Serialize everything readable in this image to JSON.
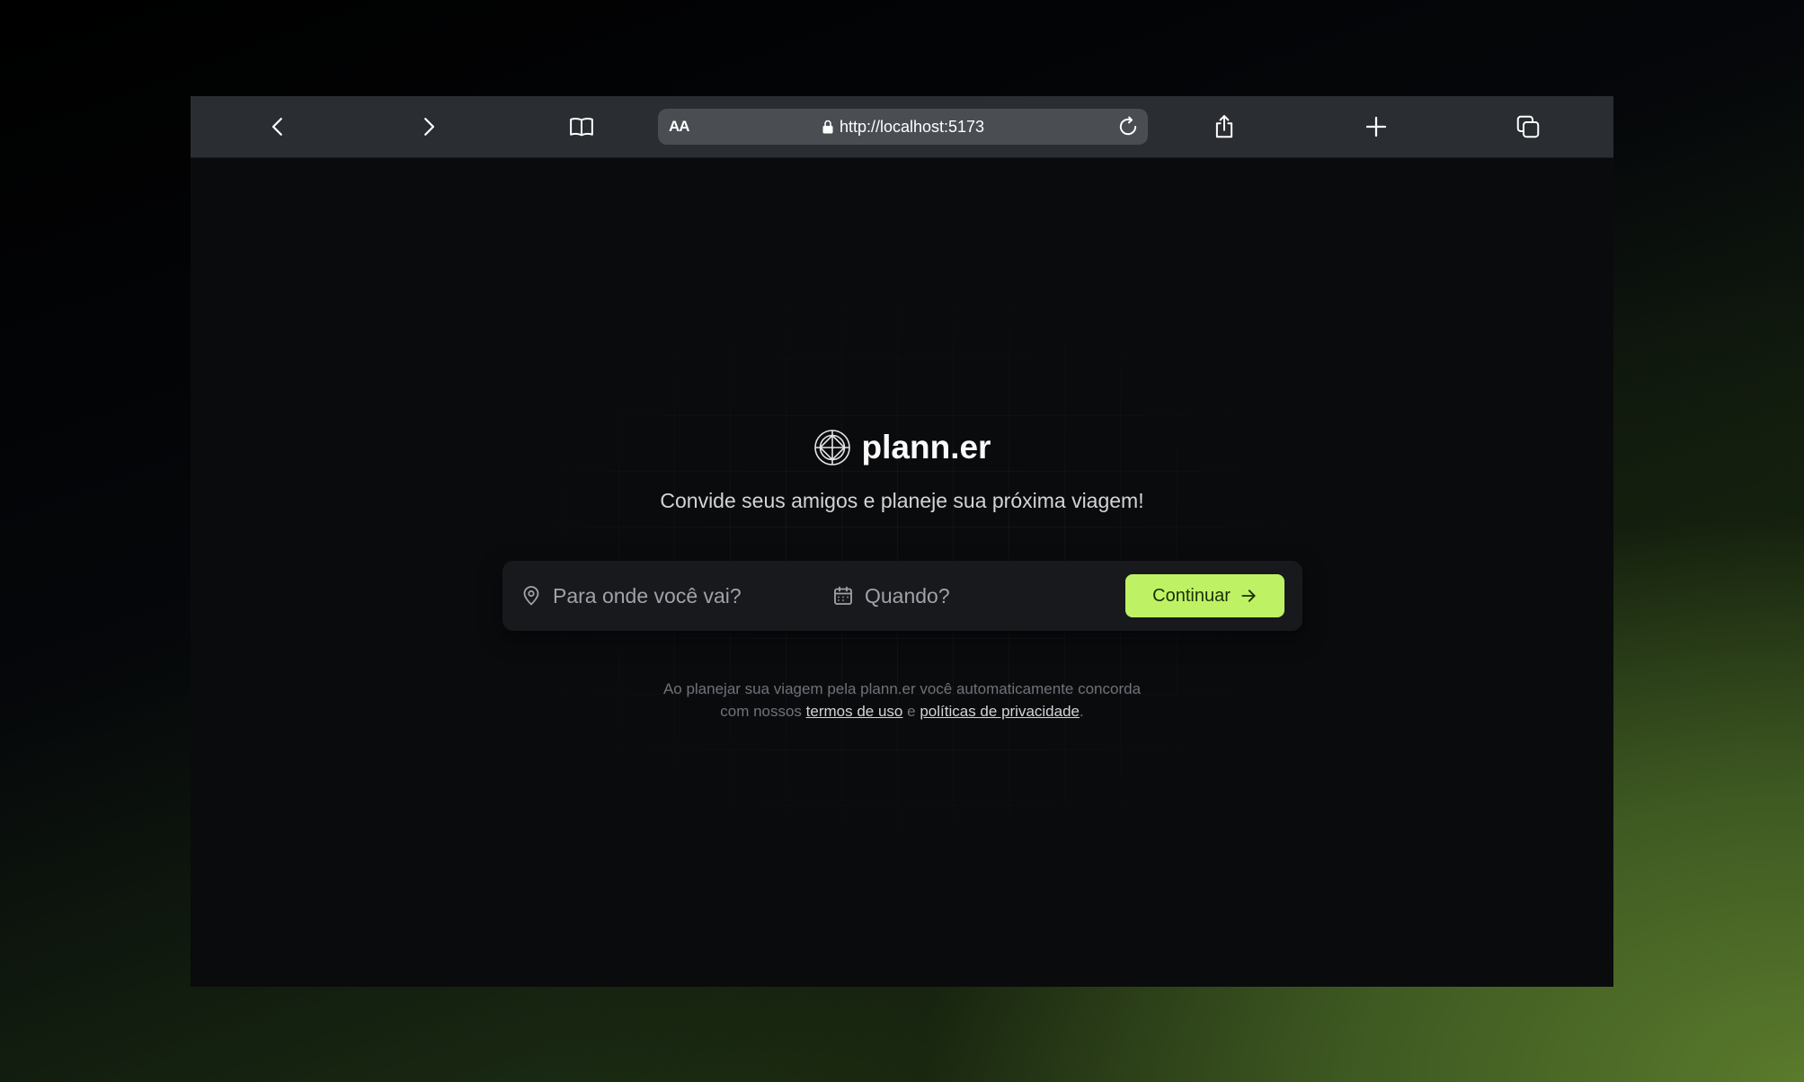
{
  "browser": {
    "text_size_label": "AA",
    "url": "http://localhost:5173",
    "icons": {
      "back": "chevron-left-icon",
      "forward": "chevron-right-icon",
      "bookmarks": "book-icon",
      "reload": "reload-icon",
      "share": "share-icon",
      "new_tab": "plus-icon",
      "tabs": "tabs-icon"
    }
  },
  "app": {
    "logo_text": "plann.er",
    "tagline": "Convide seus amigos e planeje sua próxima viagem!",
    "destination_placeholder": "Para onde você vai?",
    "date_placeholder": "Quando?",
    "continue_label": "Continuar",
    "legal": {
      "line1": "Ao planejar sua viagem pela plann.er você automaticamente concorda",
      "line2_prefix": "com nossos",
      "terms_link": "termos de uso",
      "conjunction": "e",
      "privacy_link": "políticas de privacidade",
      "suffix": "."
    }
  },
  "colors": {
    "accent": "#bef264",
    "background": "#0a0b0d",
    "toolbar": "#2a2d31"
  }
}
